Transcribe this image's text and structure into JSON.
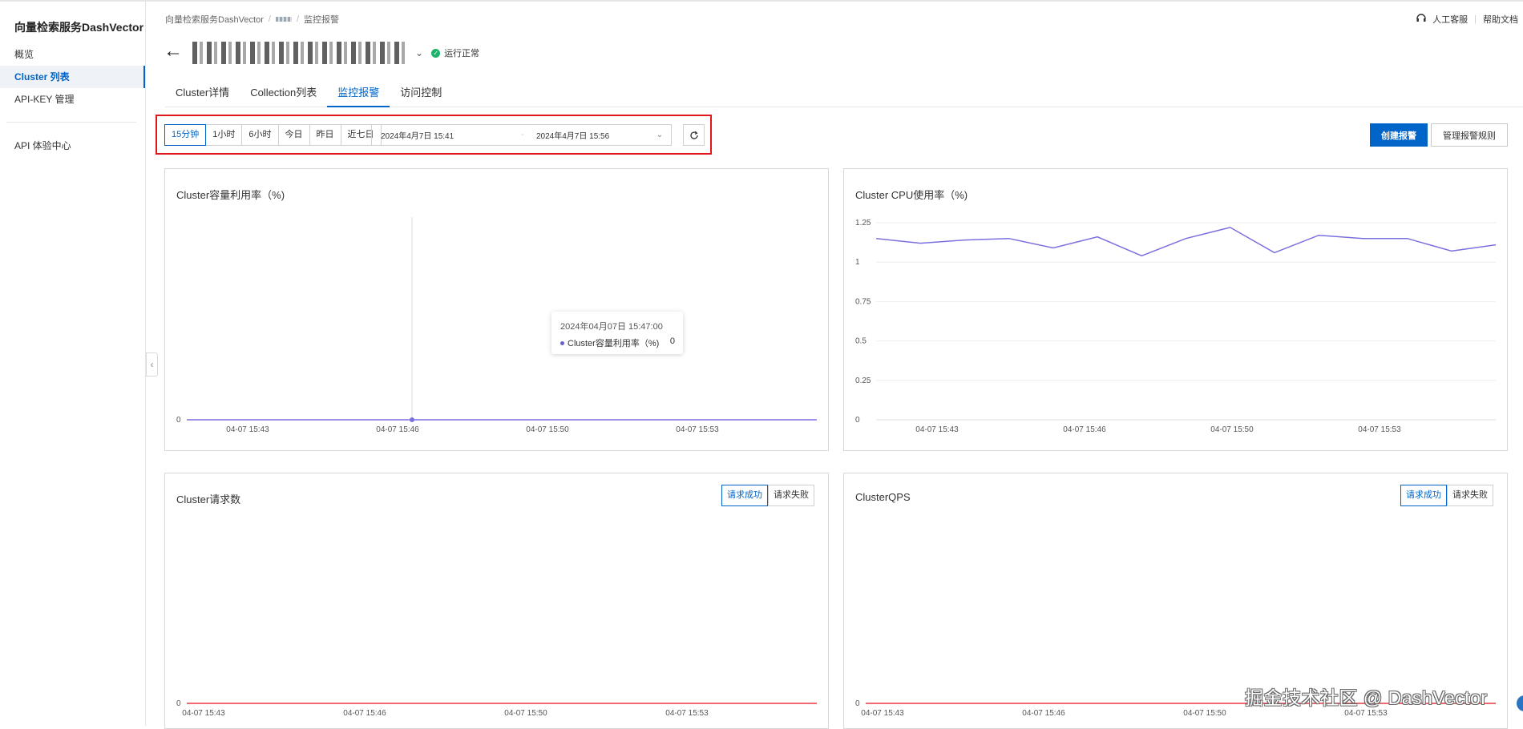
{
  "sidebar": {
    "brand": "向量检索服务DashVector",
    "items": [
      {
        "label": "概览",
        "active": false
      },
      {
        "label": "Cluster 列表",
        "active": true
      },
      {
        "label": "API-KEY 管理",
        "active": false
      },
      {
        "label": "API 体验中心",
        "active": false
      }
    ]
  },
  "breadcrumb": {
    "root": "向量检索服务DashVector",
    "current": "监控报警"
  },
  "top_right": {
    "support": "人工客服",
    "docs": "帮助文档"
  },
  "page": {
    "status": "运行正常"
  },
  "tabs": [
    {
      "label": "Cluster详情",
      "active": false
    },
    {
      "label": "Collection列表",
      "active": false
    },
    {
      "label": "监控报警",
      "active": true
    },
    {
      "label": "访问控制",
      "active": false
    }
  ],
  "toolbar": {
    "ranges": [
      "15分钟",
      "1小时",
      "6小时",
      "今日",
      "昨日",
      "近七日"
    ],
    "selected_range": "15分钟",
    "start": "2024年4月7日 15:41",
    "separator": "-",
    "end": "2024年4月7日 15:56",
    "create_alarm": "创建报警",
    "manage_rules": "管理报警规则"
  },
  "cards": {
    "capacity": {
      "title": "Cluster容量利用率（%)"
    },
    "cpu": {
      "title": "Cluster CPU使用率（%)"
    },
    "requests": {
      "title": "Cluster请求数",
      "seg": [
        "请求成功",
        "请求失败"
      ],
      "seg_active": "请求成功"
    },
    "qps": {
      "title": "ClusterQPS",
      "seg": [
        "请求成功",
        "请求失败"
      ],
      "seg_active": "请求成功"
    }
  },
  "tooltip": {
    "time": "2024年04月07日 15:47:00",
    "series": "Cluster容量利用率（%)",
    "value": "0"
  },
  "watermark": "掘金技术社区 @ DashVector",
  "colors": {
    "accent": "#0064c8",
    "line_purple": "#7b6fe0",
    "line_red": "#e8363d",
    "status_green": "#1bb36a",
    "highlight_red": "#e0171a"
  },
  "chart_data": [
    {
      "type": "line",
      "title": "Cluster容量利用率（%)",
      "x_ticks": [
        "04-07 15:43",
        "04-07 15:46",
        "04-07 15:50",
        "04-07 15:53"
      ],
      "y_ticks": [
        "0"
      ],
      "series": [
        {
          "name": "Cluster容量利用率（%)",
          "values": [
            0,
            0,
            0,
            0,
            0,
            0,
            0,
            0,
            0,
            0,
            0,
            0,
            0,
            0,
            0,
            0
          ]
        }
      ],
      "grid": true
    },
    {
      "type": "line",
      "title": "Cluster CPU使用率（%)",
      "x_ticks": [
        "04-07 15:43",
        "04-07 15:46",
        "04-07 15:50",
        "04-07 15:53"
      ],
      "y_ticks": [
        "0",
        "0.25",
        "0.5",
        "0.75",
        "1",
        "1.25"
      ],
      "ylim": [
        0,
        1.25
      ],
      "series": [
        {
          "values": [
            1.15,
            1.12,
            1.14,
            1.15,
            1.09,
            1.16,
            1.04,
            1.15,
            1.22,
            1.06,
            1.17,
            1.15,
            1.15,
            1.07,
            1.11
          ]
        }
      ],
      "grid": true
    },
    {
      "type": "line",
      "title": "Cluster请求数",
      "x_ticks": [
        "04-07 15:43",
        "04-07 15:46",
        "04-07 15:50",
        "04-07 15:53"
      ],
      "y_ticks": [
        "0"
      ],
      "series": [
        {
          "values": [
            0,
            0,
            0,
            0,
            0,
            0,
            0,
            0,
            0,
            0,
            0,
            0,
            0,
            0,
            0,
            0
          ]
        }
      ]
    },
    {
      "type": "line",
      "title": "ClusterQPS",
      "x_ticks": [
        "04-07 15:43",
        "04-07 15:46",
        "04-07 15:50",
        "04-07 15:53"
      ],
      "y_ticks": [
        "0"
      ],
      "series": [
        {
          "values": [
            0,
            0,
            0,
            0,
            0,
            0,
            0,
            0,
            0,
            0,
            0,
            0,
            0,
            0,
            0,
            0
          ]
        }
      ]
    }
  ]
}
